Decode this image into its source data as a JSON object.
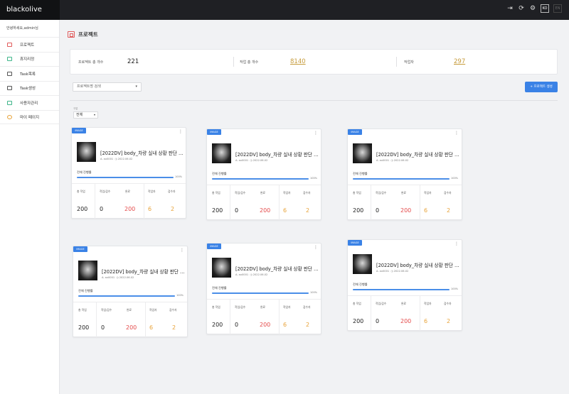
{
  "app": {
    "brand": "blackolive"
  },
  "topbar": {
    "user_initials": "KO",
    "lang": "EN"
  },
  "sidebar": {
    "greeting": "안녕하세요,admin님",
    "items": [
      {
        "label": "프로젝트",
        "color": "#e15b5b"
      },
      {
        "label": "휴지리정",
        "color": "#3fb58a"
      },
      {
        "label": "Task목록",
        "color": "#555555"
      },
      {
        "label": "Task생성",
        "color": "#555555"
      },
      {
        "label": "사용자관리",
        "color": "#3fb58a"
      },
      {
        "label": "마이 페이지",
        "color": "#e8a33a"
      }
    ]
  },
  "page": {
    "title": "프로젝트"
  },
  "stats": {
    "project_total_label": "프로젝트 총 개수",
    "project_total": "221",
    "work_total_label": "작업 총 개수",
    "work_total": "8140",
    "worker_label": "작업자",
    "worker_total": "297"
  },
  "search": {
    "placeholder": "프로젝트명 검색"
  },
  "create_button": "+ 프로젝트 생성",
  "filter": {
    "label": "구분",
    "value": "전체"
  },
  "card_labels": {
    "progress": "전체 진행률",
    "total_work": "총 작업",
    "work_inspect": "작업/검수",
    "done": "완료",
    "worker": "작업자",
    "inspector": "검수자"
  },
  "projects": [
    {
      "badge": "IMAGE",
      "title": "[2022DV] body_차량 실내 상황 판단 데이터...",
      "owner": "A. ax0001",
      "date": "2022.06.02",
      "progress": 1.0,
      "progress_text": "100%",
      "total": "200",
      "in_progress": "0",
      "done": "200",
      "workers": "6",
      "inspectors": "2"
    },
    {
      "badge": "IMAGE",
      "title": "[2022DV] body_차량 실내 상황 판단 데이터...",
      "owner": "A. ax0001",
      "date": "2022.06.02",
      "progress": 1.0,
      "progress_text": "100%",
      "total": "200",
      "in_progress": "0",
      "done": "200",
      "workers": "6",
      "inspectors": "2"
    },
    {
      "badge": "IMAGE",
      "title": "[2022DV] body_차량 실내 상황 판단 데이터...",
      "owner": "A. ax0001",
      "date": "2022.06.02",
      "progress": 1.0,
      "progress_text": "100%",
      "total": "200",
      "in_progress": "0",
      "done": "200",
      "workers": "6",
      "inspectors": "2"
    },
    {
      "badge": "IMAGE",
      "title": "[2022DV] body_차량 실내 상황 판단 데이터...",
      "owner": "A. ax0001",
      "date": "2022.06.02",
      "progress": 1.0,
      "progress_text": "100%",
      "total": "200",
      "in_progress": "0",
      "done": "200",
      "workers": "6",
      "inspectors": "2"
    },
    {
      "badge": "IMAGE",
      "title": "[2022DV] body_차량 실내 상황 판단 데이터...",
      "owner": "A. ax0001",
      "date": "2022.06.02",
      "progress": 1.0,
      "progress_text": "100%",
      "total": "200",
      "in_progress": "0",
      "done": "200",
      "workers": "6",
      "inspectors": "2"
    },
    {
      "badge": "IMAGE",
      "title": "[2022DV] body_차량 실내 상황 판단 데이터...",
      "owner": "A. ax0001",
      "date": "2022.06.02",
      "progress": 1.0,
      "progress_text": "100%",
      "total": "200",
      "in_progress": "0",
      "done": "200",
      "workers": "6",
      "inspectors": "2"
    }
  ]
}
